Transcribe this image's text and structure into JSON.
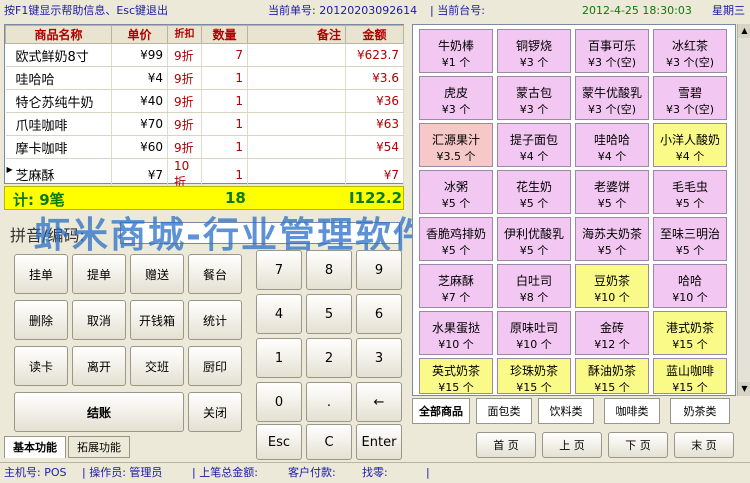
{
  "topbar": {
    "help": "按F1键显示帮助信息、Esc键退出",
    "order_label": "当前单号: 20120203092614",
    "table_label": "| 当前台号:",
    "datetime": "2012-4-25 18:30:03",
    "weekday": "星期三"
  },
  "order_table": {
    "headers": [
      "商品名称",
      "单价",
      "折扣",
      "数量",
      "备注",
      "金额"
    ],
    "rows": [
      {
        "name": "欧式鲜奶8寸",
        "price": "¥99",
        "discount": "9折",
        "qty": "7",
        "note": "",
        "amount": "¥623.7"
      },
      {
        "name": "哇哈哈",
        "price": "¥4",
        "discount": "9折",
        "qty": "1",
        "note": "",
        "amount": "¥3.6"
      },
      {
        "name": "特仑苏纯牛奶",
        "price": "¥40",
        "discount": "9折",
        "qty": "1",
        "note": "",
        "amount": "¥36"
      },
      {
        "name": "爪哇咖啡",
        "price": "¥70",
        "discount": "9折",
        "qty": "1",
        "note": "",
        "amount": "¥63"
      },
      {
        "name": "摩卡咖啡",
        "price": "¥60",
        "discount": "9折",
        "qty": "1",
        "note": "",
        "amount": "¥54"
      },
      {
        "name": "芝麻酥",
        "price": "¥7",
        "discount": "10折",
        "qty": "1",
        "note": "",
        "amount": "¥7"
      }
    ]
  },
  "totals": {
    "count_label": "计: 9笔",
    "qty_total": "18",
    "amount_total": "I122.2"
  },
  "pinyin": {
    "label": "拼音/编码:",
    "value": ""
  },
  "watermark": "虾米商城-行业管理软件综合店",
  "function_buttons": [
    "挂单",
    "提单",
    "赠送",
    "餐台",
    "删除",
    "取消",
    "开钱箱",
    "统计",
    "读卡",
    "离开",
    "交班",
    "厨印",
    "结账",
    "关闭"
  ],
  "numpad": [
    "7",
    "8",
    "9",
    "4",
    "5",
    "6",
    "1",
    "2",
    "3",
    "0",
    ".",
    "←",
    "Esc",
    "C",
    "Enter"
  ],
  "left_tabs": [
    "基本功能",
    "拓展功能"
  ],
  "products": [
    {
      "name": "牛奶棒",
      "price": "¥1 个",
      "color": "pink"
    },
    {
      "name": "铜锣烧",
      "price": "¥3 个",
      "color": "pink"
    },
    {
      "name": "百事可乐",
      "price": "¥3 个(空)",
      "color": "pink"
    },
    {
      "name": "冰红茶",
      "price": "¥3 个(空)",
      "color": "pink"
    },
    {
      "name": "虎皮",
      "price": "¥3 个",
      "color": "pink"
    },
    {
      "name": "蒙古包",
      "price": "¥3 个",
      "color": "pink"
    },
    {
      "name": "蒙牛优酸乳",
      "price": "¥3 个(空)",
      "color": "pink"
    },
    {
      "name": "雪碧",
      "price": "¥3 个(空)",
      "color": "pink"
    },
    {
      "name": "汇源果汁",
      "price": "¥3.5 个",
      "color": "red"
    },
    {
      "name": "提子面包",
      "price": "¥4 个",
      "color": "pink"
    },
    {
      "name": "哇哈哈",
      "price": "¥4 个",
      "color": "pink"
    },
    {
      "name": "小洋人酸奶",
      "price": "¥4 个",
      "color": "yellow"
    },
    {
      "name": "冰粥",
      "price": "¥5 个",
      "color": "pink"
    },
    {
      "name": "花生奶",
      "price": "¥5 个",
      "color": "pink"
    },
    {
      "name": "老婆饼",
      "price": "¥5 个",
      "color": "pink"
    },
    {
      "name": "毛毛虫",
      "price": "¥5 个",
      "color": "pink"
    },
    {
      "name": "香脆鸡排奶",
      "price": "¥5 个",
      "color": "pink"
    },
    {
      "name": "伊利优酸乳",
      "price": "¥5 个",
      "color": "pink"
    },
    {
      "name": "海苏夫奶茶",
      "price": "¥5 个",
      "color": "pink"
    },
    {
      "name": "至味三明治",
      "price": "¥5 个",
      "color": "pink"
    },
    {
      "name": "芝麻酥",
      "price": "¥7 个",
      "color": "pink"
    },
    {
      "name": "白吐司",
      "price": "¥8 个",
      "color": "pink"
    },
    {
      "name": "豆奶茶",
      "price": "¥10 个",
      "color": "yellow"
    },
    {
      "name": "哈哈",
      "price": "¥10 个",
      "color": "pink"
    },
    {
      "name": "水果蛋挞",
      "price": "¥10 个",
      "color": "pink"
    },
    {
      "name": "原味吐司",
      "price": "¥10 个",
      "color": "pink"
    },
    {
      "name": "金砖",
      "price": "¥12 个",
      "color": "pink"
    },
    {
      "name": "港式奶茶",
      "price": "¥15 个",
      "color": "yellow"
    },
    {
      "name": "英式奶茶",
      "price": "¥15 个",
      "color": "yellow"
    },
    {
      "name": "珍珠奶茶",
      "price": "¥15 个",
      "color": "yellow"
    },
    {
      "name": "酥油奶茶",
      "price": "¥15 个",
      "color": "yellow"
    },
    {
      "name": "蓝山咖啡",
      "price": "¥15 个",
      "color": "yellow"
    }
  ],
  "categories": [
    "全部商品",
    "面包类",
    "饮料类",
    "咖啡类",
    "奶茶类"
  ],
  "pager": [
    "首 页",
    "上 页",
    "下 页",
    "末 页"
  ],
  "status": {
    "host": "主机号: POS",
    "operator": "| 操作员: 管理员",
    "last_total": "| 上笔总金额:",
    "paid": "客户付款:",
    "change": "找零:",
    "end": "|"
  },
  "colors": {
    "pink": "#f2c8f2",
    "red": "#f6c8c8",
    "yellow": "#fafa88",
    "total_bar": "#ffff00",
    "header_text": "#1a1aa6",
    "discount_text": "#b00000"
  }
}
